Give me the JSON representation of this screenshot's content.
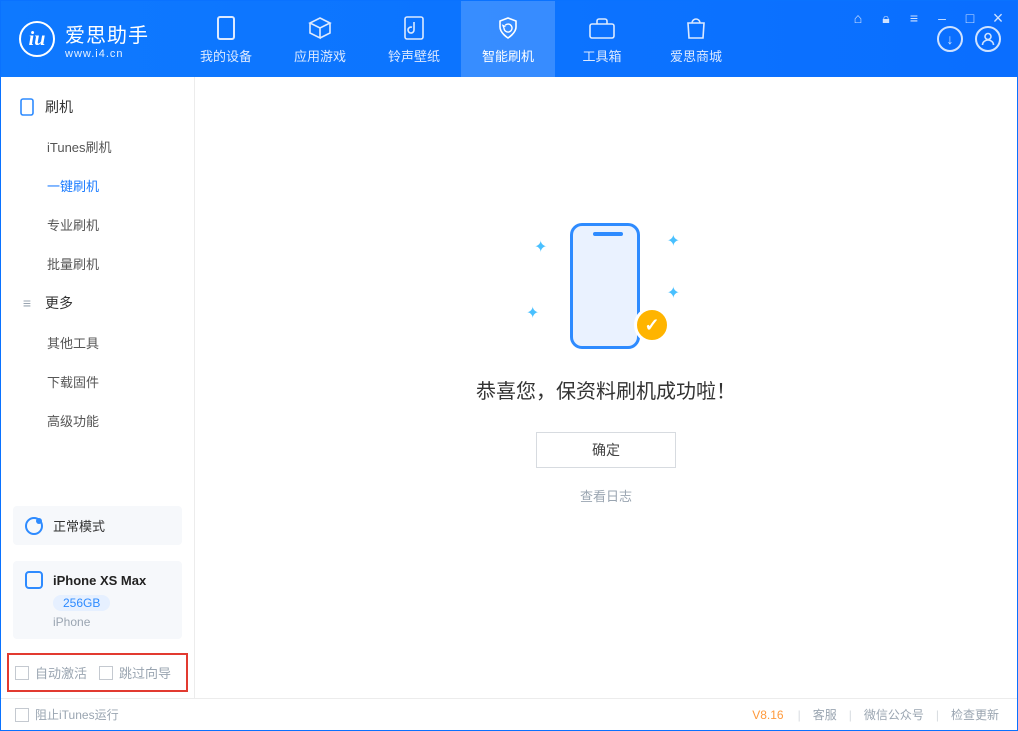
{
  "app": {
    "name": "爱思助手",
    "site": "www.i4.cn"
  },
  "header_tabs": [
    {
      "label": "我的设备",
      "icon": "device"
    },
    {
      "label": "应用游戏",
      "icon": "cube"
    },
    {
      "label": "铃声壁纸",
      "icon": "music"
    },
    {
      "label": "智能刷机",
      "icon": "refresh",
      "active": true
    },
    {
      "label": "工具箱",
      "icon": "toolbox"
    },
    {
      "label": "爱思商城",
      "icon": "bag"
    }
  ],
  "window_buttons": {
    "shirt": "icon",
    "lock": "icon",
    "menu": "icon",
    "min": "–",
    "max": "□",
    "close": "×"
  },
  "header_icons": {
    "download": "↓",
    "user": "☺"
  },
  "sidebar": {
    "sections": [
      {
        "title": "刷机",
        "icon": "phone",
        "items": [
          "iTunes刷机",
          "一键刷机",
          "专业刷机",
          "批量刷机"
        ],
        "active_index": 1
      },
      {
        "title": "更多",
        "icon": "list",
        "items": [
          "其他工具",
          "下载固件",
          "高级功能"
        ],
        "active_index": -1
      }
    ],
    "mode_label": "正常模式",
    "device": {
      "name": "iPhone XS Max",
      "storage": "256GB",
      "type": "iPhone"
    },
    "bottom_checks": [
      "自动激活",
      "跳过向导"
    ]
  },
  "main": {
    "success_msg": "恭喜您，保资料刷机成功啦！",
    "ok_button": "确定",
    "view_log": "查看日志"
  },
  "footer": {
    "stop_itunes": "阻止iTunes运行",
    "version": "V8.16",
    "links": [
      "客服",
      "微信公众号",
      "检查更新"
    ]
  },
  "colors": {
    "primary": "#0e79ff",
    "accent": "#ffb400",
    "muted": "#9aa5b1",
    "highlight_border": "#e23a30"
  }
}
